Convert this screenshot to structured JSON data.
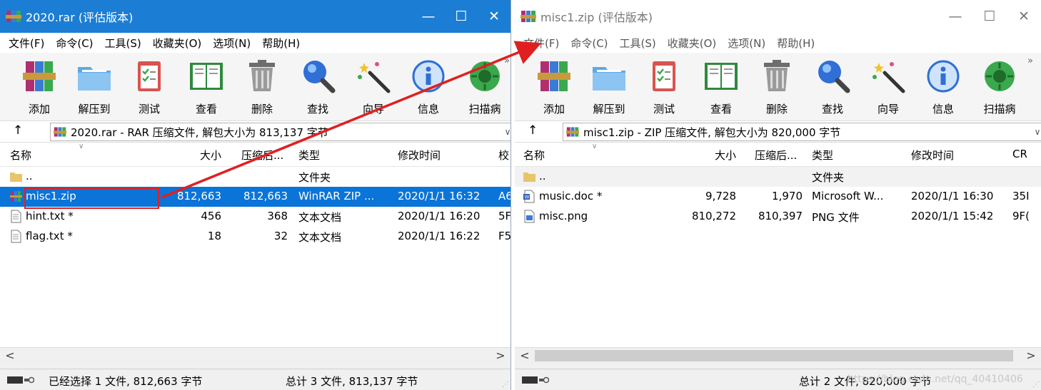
{
  "left_window": {
    "title": "2020.rar (评估版本)",
    "controls": {
      "minimize": "—",
      "maximize": "☐",
      "close": "✕"
    },
    "menu": [
      "文件(F)",
      "命令(C)",
      "工具(S)",
      "收藏夹(O)",
      "选项(N)",
      "帮助(H)"
    ],
    "toolbar": [
      "添加",
      "解压到",
      "测试",
      "查看",
      "删除",
      "查找",
      "向导",
      "信息",
      "扫描病"
    ],
    "toolbar_more": "»",
    "up": "↑",
    "address": "2020.rar - RAR 压缩文件, 解包大小为 813,137 字节",
    "dropdown": "∨",
    "sort_arrow": "∨",
    "columns": [
      "名称",
      "大小",
      "压缩后...",
      "类型",
      "修改时间",
      "校"
    ],
    "rows": [
      {
        "name": "..",
        "size": "",
        "packed": "",
        "type": "文件夹",
        "modified": "",
        "crc": "",
        "icon": "folder-icon"
      },
      {
        "name": "misc1.zip",
        "size": "812,663",
        "packed": "812,663",
        "type": "WinRAR ZIP ...",
        "modified": "2020/1/1 16:32",
        "crc": "A6",
        "icon": "zip-archive-icon",
        "selected": true
      },
      {
        "name": "hint.txt *",
        "size": "456",
        "packed": "368",
        "type": "文本文档",
        "modified": "2020/1/1 16:20",
        "crc": "5F",
        "icon": "text-file-icon"
      },
      {
        "name": "flag.txt *",
        "size": "18",
        "packed": "32",
        "type": "文本文档",
        "modified": "2020/1/1 16:22",
        "crc": "F5",
        "icon": "text-file-icon"
      }
    ],
    "scroll": {
      "left": "<",
      "right": ">"
    },
    "status_left": "已经选择 1 文件, 812,663 字节",
    "status_right": "总计 3 文件, 813,137 字节"
  },
  "right_window": {
    "title": "misc1.zip (评估版本)",
    "controls": {
      "minimize": "—",
      "maximize": "☐",
      "close": "✕"
    },
    "menu": [
      "文件(F)",
      "命令(C)",
      "工具(S)",
      "收藏夹(O)",
      "选项(N)",
      "帮助(H)"
    ],
    "toolbar": [
      "添加",
      "解压到",
      "测试",
      "查看",
      "删除",
      "查找",
      "向导",
      "信息",
      "扫描病"
    ],
    "toolbar_more": "»",
    "up": "↑",
    "address": "misc1.zip - ZIP 压缩文件, 解包大小为 820,000 字节",
    "dropdown": "∨",
    "sort_arrow": "∨",
    "columns": [
      "名称",
      "大小",
      "压缩后...",
      "类型",
      "修改时间",
      "CR"
    ],
    "rows": [
      {
        "name": "..",
        "size": "",
        "packed": "",
        "type": "文件夹",
        "modified": "",
        "crc": "",
        "icon": "folder-icon"
      },
      {
        "name": "music.doc *",
        "size": "9,728",
        "packed": "1,970",
        "type": "Microsoft W...",
        "modified": "2020/1/1 16:30",
        "crc": "35I",
        "icon": "word-doc-icon"
      },
      {
        "name": "misc.png",
        "size": "810,272",
        "packed": "810,397",
        "type": "PNG 文件",
        "modified": "2020/1/1 15:42",
        "crc": "9F(",
        "icon": "image-file-icon"
      }
    ],
    "scroll": {
      "left": "<",
      "right": ">"
    },
    "status_right": "总计 2 文件, 820,000 字节",
    "watermark": "https://blog.csdn.net/qq_40410406"
  },
  "colors": {
    "active_title_bar": "#1b7ed4",
    "selection": "#0a74d8",
    "annotation_red": "#e02020",
    "alt_row": "#f2f2f2"
  }
}
